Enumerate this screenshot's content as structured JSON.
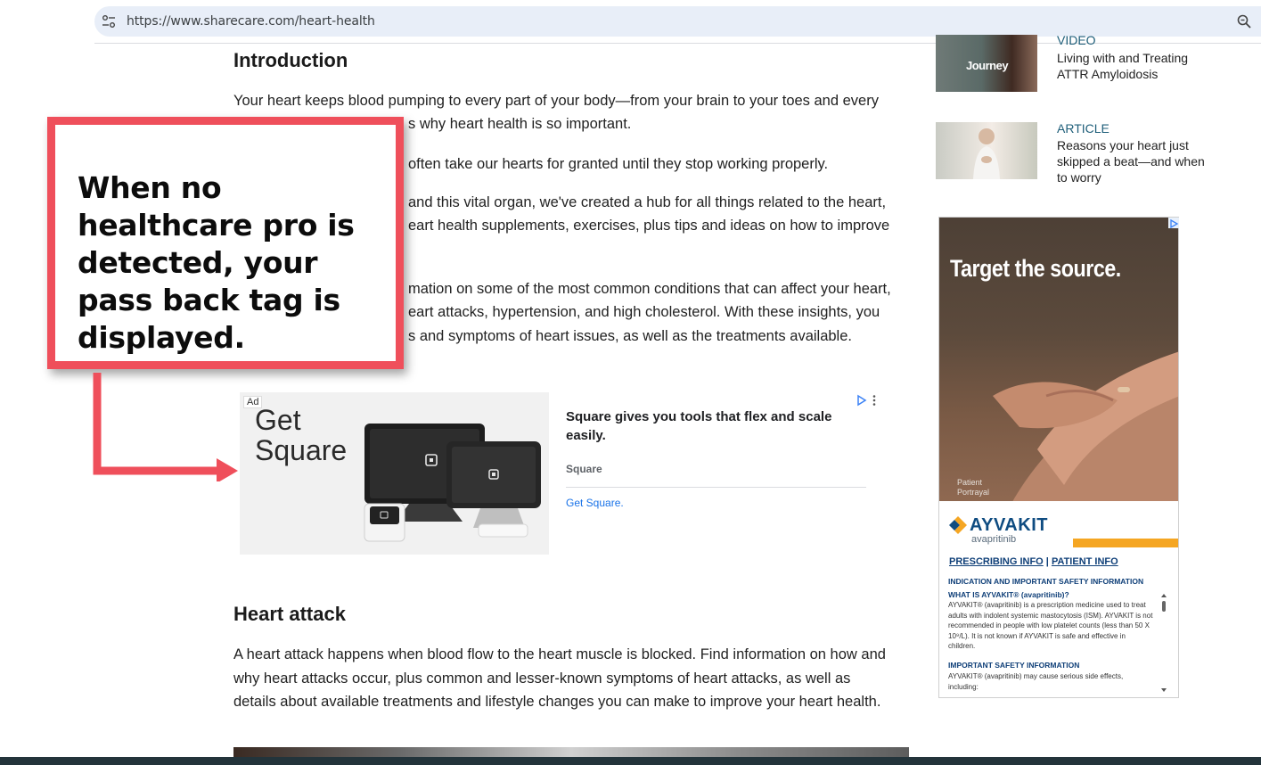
{
  "browser": {
    "url": "https://www.sharecare.com/heart-health"
  },
  "article": {
    "intro_heading": "Introduction",
    "intro_paragraphs": [
      "Your heart keeps blood pumping to every part of your body—from your brain to your toes and every",
      "s why heart health is so important.",
      "often take our hearts for granted until they stop working properly.",
      "and this vital organ, we've created a hub for all things related to the heart,",
      "eart health supplements, exercises, plus tips and ideas on how to improve",
      "mation on some of the most common conditions that can affect your heart,",
      "eart attacks, hypertension, and high cholesterol. With these insights, you",
      "s and symptoms of heart issues, as well as the treatments available."
    ],
    "heart_attack_heading": "Heart attack",
    "heart_attack_lines": [
      "A heart attack happens when blood flow to the heart muscle is blocked. Find information on how and",
      "why heart attacks occur, plus common and lesser-known symptoms of heart attacks, as well as",
      "details about available treatments and lifestyle changes you can make to improve your heart health."
    ]
  },
  "inline_ad": {
    "badge": "Ad",
    "image_text_line1": "Get",
    "image_text_line2": "Square",
    "headline": "Square gives you tools that flex and scale easily.",
    "advertiser": "Square",
    "cta": "Get Square.",
    "choices_icon": "adchoices-icon"
  },
  "callout": {
    "text": "When no healthcare pro is detected, your pass back tag is displayed.",
    "border_color": "#ef4f5b"
  },
  "sidebar": {
    "items": [
      {
        "kicker": "VIDEO",
        "title": "Living with and Treating ATTR Amyloidosis",
        "thumb_text": "Journey"
      },
      {
        "kicker": "ARTICLE",
        "title": "Reasons your heart just skipped a beat—and when to worry"
      }
    ]
  },
  "right_ad": {
    "headline": "Target the source.",
    "portrayal": "Patient Portrayal",
    "brand": "AYVAKIT",
    "brand_sub": "avapritinib",
    "link_prescribing": "PRESCRIBING INFO",
    "link_separator": "|",
    "link_patient": "PATIENT INFO",
    "isi_heading": "INDICATION AND IMPORTANT SAFETY INFORMATION",
    "what_is": "WHAT IS AYVAKIT® (avapritinib)?",
    "what_is_body": "AYVAKIT® (avapritinib) is a prescription medicine used to treat adults with indolent systemic mastocytosis (ISM). AYVAKIT is not recommended in people with low platelet counts (less than 50 X 10⁹/L). It is not known if AYVAKIT is safe and effective in children.",
    "safety_heading": "IMPORTANT SAFETY INFORMATION",
    "safety_body": "AYVAKIT® (avapritinib) may cause serious side effects, including:",
    "accent_color": "#f5a623"
  }
}
